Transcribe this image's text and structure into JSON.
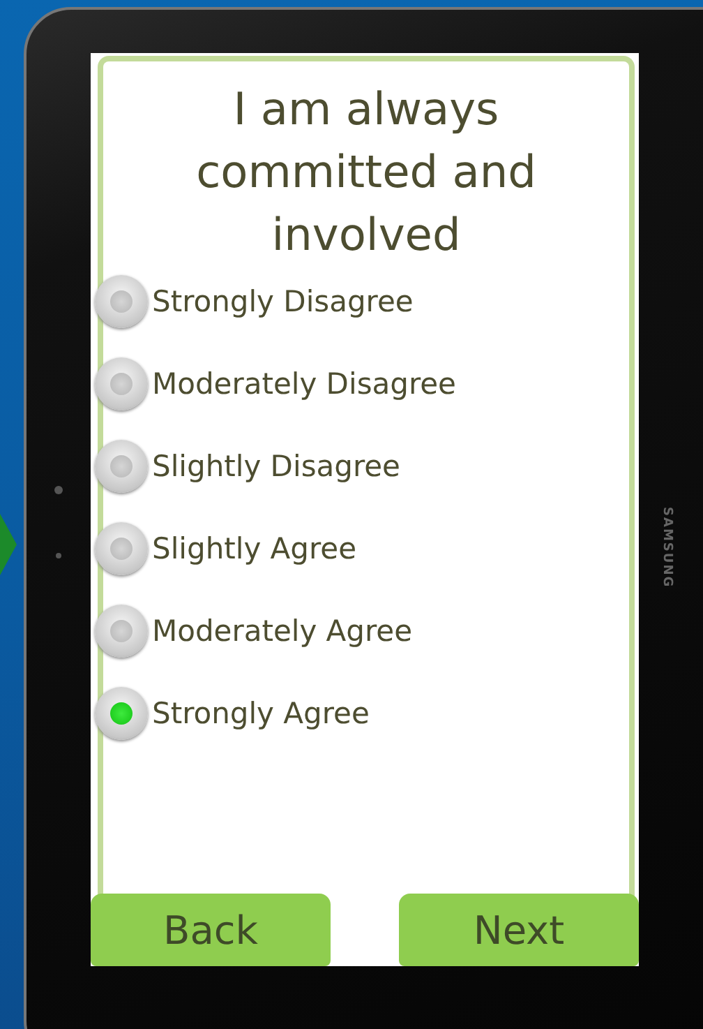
{
  "device_brand": "SAMSUNG",
  "question": {
    "title": "I am always committed and involved"
  },
  "options": [
    {
      "label": "Strongly Disagree",
      "selected": false
    },
    {
      "label": "Moderately Disagree",
      "selected": false
    },
    {
      "label": "Slightly Disagree",
      "selected": false
    },
    {
      "label": "Slightly Agree",
      "selected": false
    },
    {
      "label": "Moderately Agree",
      "selected": false
    },
    {
      "label": "Strongly Agree",
      "selected": true
    }
  ],
  "buttons": [
    {
      "label": "Back"
    },
    {
      "label": "Next"
    }
  ]
}
